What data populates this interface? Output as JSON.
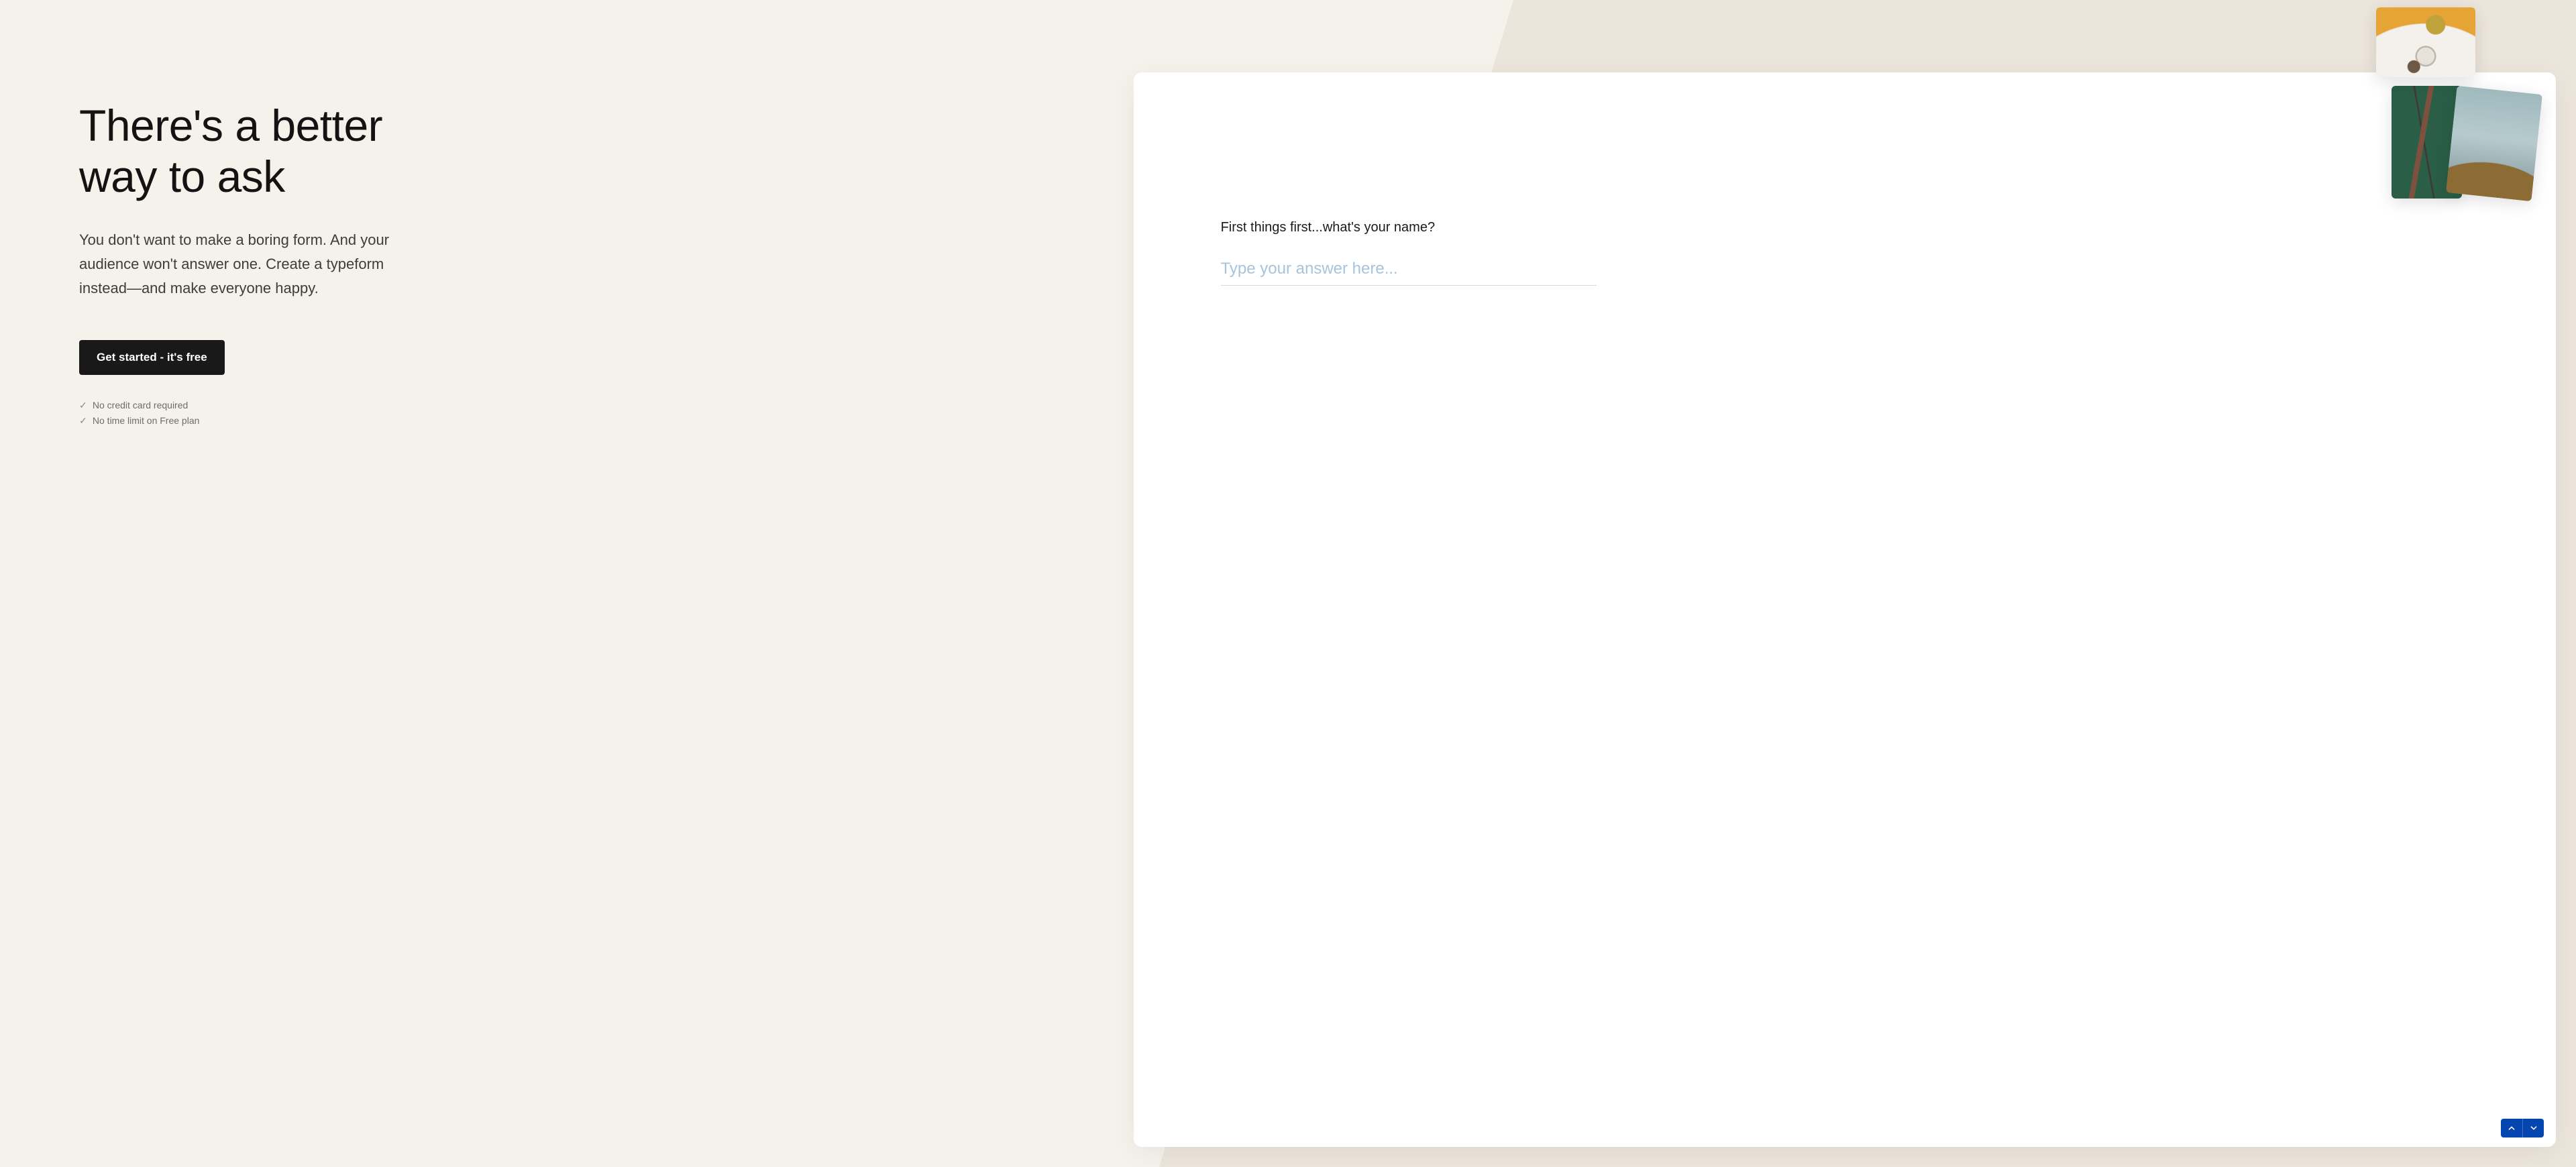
{
  "hero": {
    "headline_line1": "There's a better",
    "headline_line2": "way to ask",
    "subtext": "You don't want to make a boring form. And your audience won't answer one. Create a typeform instead—and make everyone happy.",
    "cta_label": "Get started - it's free",
    "bullets": [
      "No credit card required",
      "No time limit on Free plan"
    ]
  },
  "form_preview": {
    "question": "First things first...what's your name?",
    "answer_value": "",
    "answer_placeholder": "Type your answer here...",
    "nav": {
      "up_label": "Previous question",
      "down_label": "Next question"
    }
  },
  "colors": {
    "page_bg": "#f5f1eb",
    "page_bg_alt": "#ece5db",
    "text_primary": "#131313",
    "text_secondary": "#3d3d3c",
    "text_muted": "#6d6d6c",
    "cta_bg": "#191919",
    "nav_accent": "#0445af",
    "input_underline": "#c9dbe8",
    "input_placeholder": "#a8c4db"
  },
  "decorative_photos": [
    {
      "name": "photo-table-coffee",
      "alt": "Overhead of a round white table with a cup and hands"
    },
    {
      "name": "photo-chair",
      "alt": "Folding chair on a green floor"
    },
    {
      "name": "photo-underwater",
      "alt": "Underwater coral scene"
    }
  ]
}
